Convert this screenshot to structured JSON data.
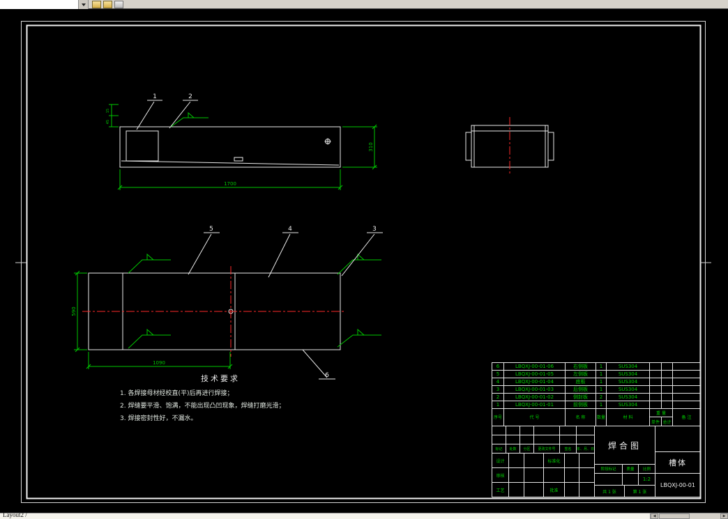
{
  "window": {
    "layout_tab": "Layout2",
    "tab_divider": "/"
  },
  "toolbar": {
    "icon_names": [
      "dropdown-arrow-icon",
      "open-icon",
      "save-icon",
      "print-icon"
    ]
  },
  "drawing": {
    "tech_requirements": {
      "title": "技术要求",
      "items": [
        "1. 各焊接母材经校直(平)后再进行焊接；",
        "2. 焊缝要平滑、饱满，不能出现凸凹现象，焊缝打磨光滑；",
        "3. 焊接密封性好，不漏水。"
      ]
    },
    "balloons": {
      "b1": "1",
      "b2": "2",
      "b3": "3",
      "b4": "4",
      "b5": "5",
      "b6": "6"
    },
    "dimensions": {
      "top_length": "1700",
      "top_height": "310",
      "top_small_a": "15",
      "top_small_b": "45",
      "plan_width": "590",
      "plan_bottom": "1090"
    }
  },
  "bom": {
    "headers": {
      "seq": "序号",
      "code": "代  号",
      "name": "名  称",
      "qty": "数量",
      "material": "材  料",
      "weight": "重 量",
      "unit": "单件",
      "total": "总计",
      "notes": "备  注"
    },
    "rows": [
      {
        "seq": "6",
        "code": "LBQXJ-00-01-06",
        "name": "右侧板",
        "qty": "1",
        "material": "SUS304"
      },
      {
        "seq": "5",
        "code": "LBQXJ-00-01-05",
        "name": "左侧板",
        "qty": "1",
        "material": "SUS304"
      },
      {
        "seq": "4",
        "code": "LBQXJ-00-01-04",
        "name": "底板",
        "qty": "1",
        "material": "SUS304"
      },
      {
        "seq": "3",
        "code": "LBQXJ-00-01-03",
        "name": "后侧板",
        "qty": "1",
        "material": "SUS304"
      },
      {
        "seq": "2",
        "code": "LBQXJ-00-01-02",
        "name": "侧封板",
        "qty": "2",
        "material": "SUS304"
      },
      {
        "seq": "1",
        "code": "LBQXJ-00-01-01",
        "name": "前侧板",
        "qty": "1",
        "material": "SUS304"
      }
    ]
  },
  "title_block": {
    "drawing_title": "焊合图",
    "part_name": "槽体",
    "drawing_number": "LBQXJ-00-01",
    "scale_value": "1:2",
    "sheet_total": "共 1 张",
    "sheet_current": "第 1 张",
    "labels": {
      "mark": "标记",
      "count": "处数",
      "zone": "分区",
      "change_doc": "更改文件号",
      "sign": "签名",
      "date": "年、月、日",
      "design": "设计",
      "standardize": "标准化",
      "check": "审核",
      "process": "工艺",
      "approve": "批准",
      "stage_mark": "阶段标记",
      "weight": "质量",
      "scale": "比例"
    }
  }
}
